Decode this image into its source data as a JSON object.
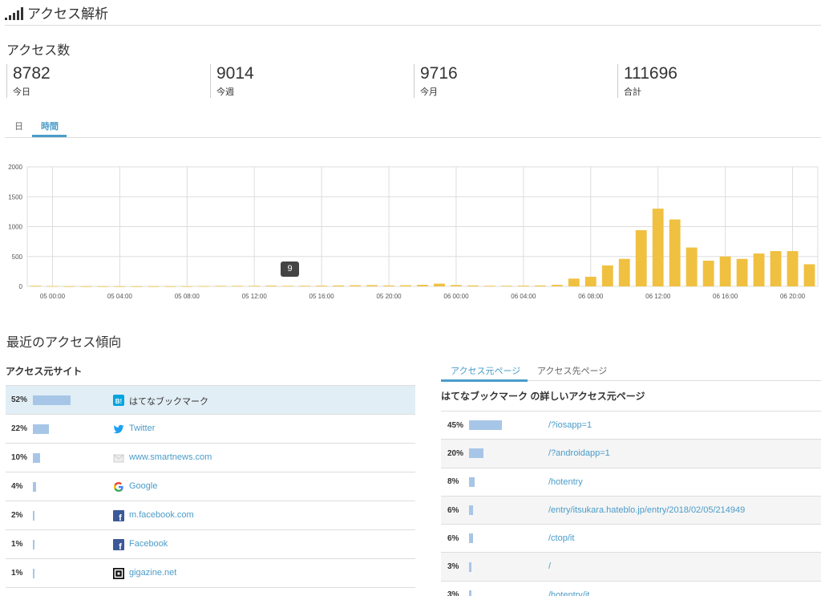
{
  "header": {
    "title": "アクセス解析",
    "icon": "signal-bars-icon"
  },
  "access": {
    "title": "アクセス数",
    "stats": [
      {
        "value": "8782",
        "label": "今日"
      },
      {
        "value": "9014",
        "label": "今週"
      },
      {
        "value": "9716",
        "label": "今月"
      },
      {
        "value": "111696",
        "label": "合計"
      }
    ]
  },
  "tabs": [
    {
      "label": "日",
      "active": false
    },
    {
      "label": "時間",
      "active": true
    }
  ],
  "tooltip": {
    "value": "9"
  },
  "chart_data": {
    "type": "bar",
    "color": "#f0c040",
    "ylim": [
      0,
      2000
    ],
    "yticks": [
      "0",
      "500",
      "1000",
      "1500",
      "2000"
    ],
    "xticks": [
      "05 00:00",
      "05 04:00",
      "05 08:00",
      "05 12:00",
      "05 16:00",
      "05 20:00",
      "06 00:00",
      "06 04:00",
      "06 08:00",
      "06 12:00",
      "06 16:00",
      "06 20:00"
    ],
    "values": [
      10,
      5,
      3,
      2,
      2,
      2,
      2,
      2,
      2,
      3,
      5,
      8,
      9,
      9,
      12,
      9,
      10,
      12,
      15,
      18,
      20,
      15,
      18,
      25,
      45,
      22,
      15,
      10,
      10,
      12,
      15,
      25,
      130,
      160,
      350,
      460,
      940,
      1300,
      1120,
      650,
      430,
      500,
      460,
      550,
      590,
      590,
      370
    ]
  },
  "recent": {
    "title": "最近のアクセス傾向",
    "sources_title": "アクセス元サイト",
    "sources": [
      {
        "pct": "52%",
        "frac": 0.52,
        "name": "はてなブックマーク",
        "icon": "hatena-bookmark-icon",
        "highlight": true
      },
      {
        "pct": "22%",
        "frac": 0.22,
        "name": "Twitter",
        "icon": "twitter-icon",
        "highlight": false
      },
      {
        "pct": "10%",
        "frac": 0.1,
        "name": "www.smartnews.com",
        "icon": "smartnews-icon",
        "highlight": false
      },
      {
        "pct": "4%",
        "frac": 0.04,
        "name": "Google",
        "icon": "google-icon",
        "highlight": false
      },
      {
        "pct": "2%",
        "frac": 0.02,
        "name": "m.facebook.com",
        "icon": "facebook-icon",
        "highlight": false
      },
      {
        "pct": "1%",
        "frac": 0.01,
        "name": "Facebook",
        "icon": "facebook-icon",
        "highlight": false
      },
      {
        "pct": "1%",
        "frac": 0.01,
        "name": "gigazine.net",
        "icon": "gigazine-icon",
        "highlight": false
      }
    ],
    "page_tabs": [
      {
        "label": "アクセス元ページ",
        "active": true
      },
      {
        "label": "アクセス先ページ",
        "active": false
      }
    ],
    "pages_title": "はてなブックマーク の詳しいアクセス元ページ",
    "pages": [
      {
        "pct": "45%",
        "frac": 0.45,
        "path": "/?iosapp=1"
      },
      {
        "pct": "20%",
        "frac": 0.2,
        "path": "/?androidapp=1"
      },
      {
        "pct": "8%",
        "frac": 0.08,
        "path": "/hotentry"
      },
      {
        "pct": "6%",
        "frac": 0.06,
        "path": "/entry/itsukara.hateblo.jp/entry/2018/02/05/214949"
      },
      {
        "pct": "6%",
        "frac": 0.06,
        "path": "/ctop/it"
      },
      {
        "pct": "3%",
        "frac": 0.03,
        "path": "/"
      },
      {
        "pct": "3%",
        "frac": 0.03,
        "path": "/hotentry/it"
      }
    ]
  }
}
